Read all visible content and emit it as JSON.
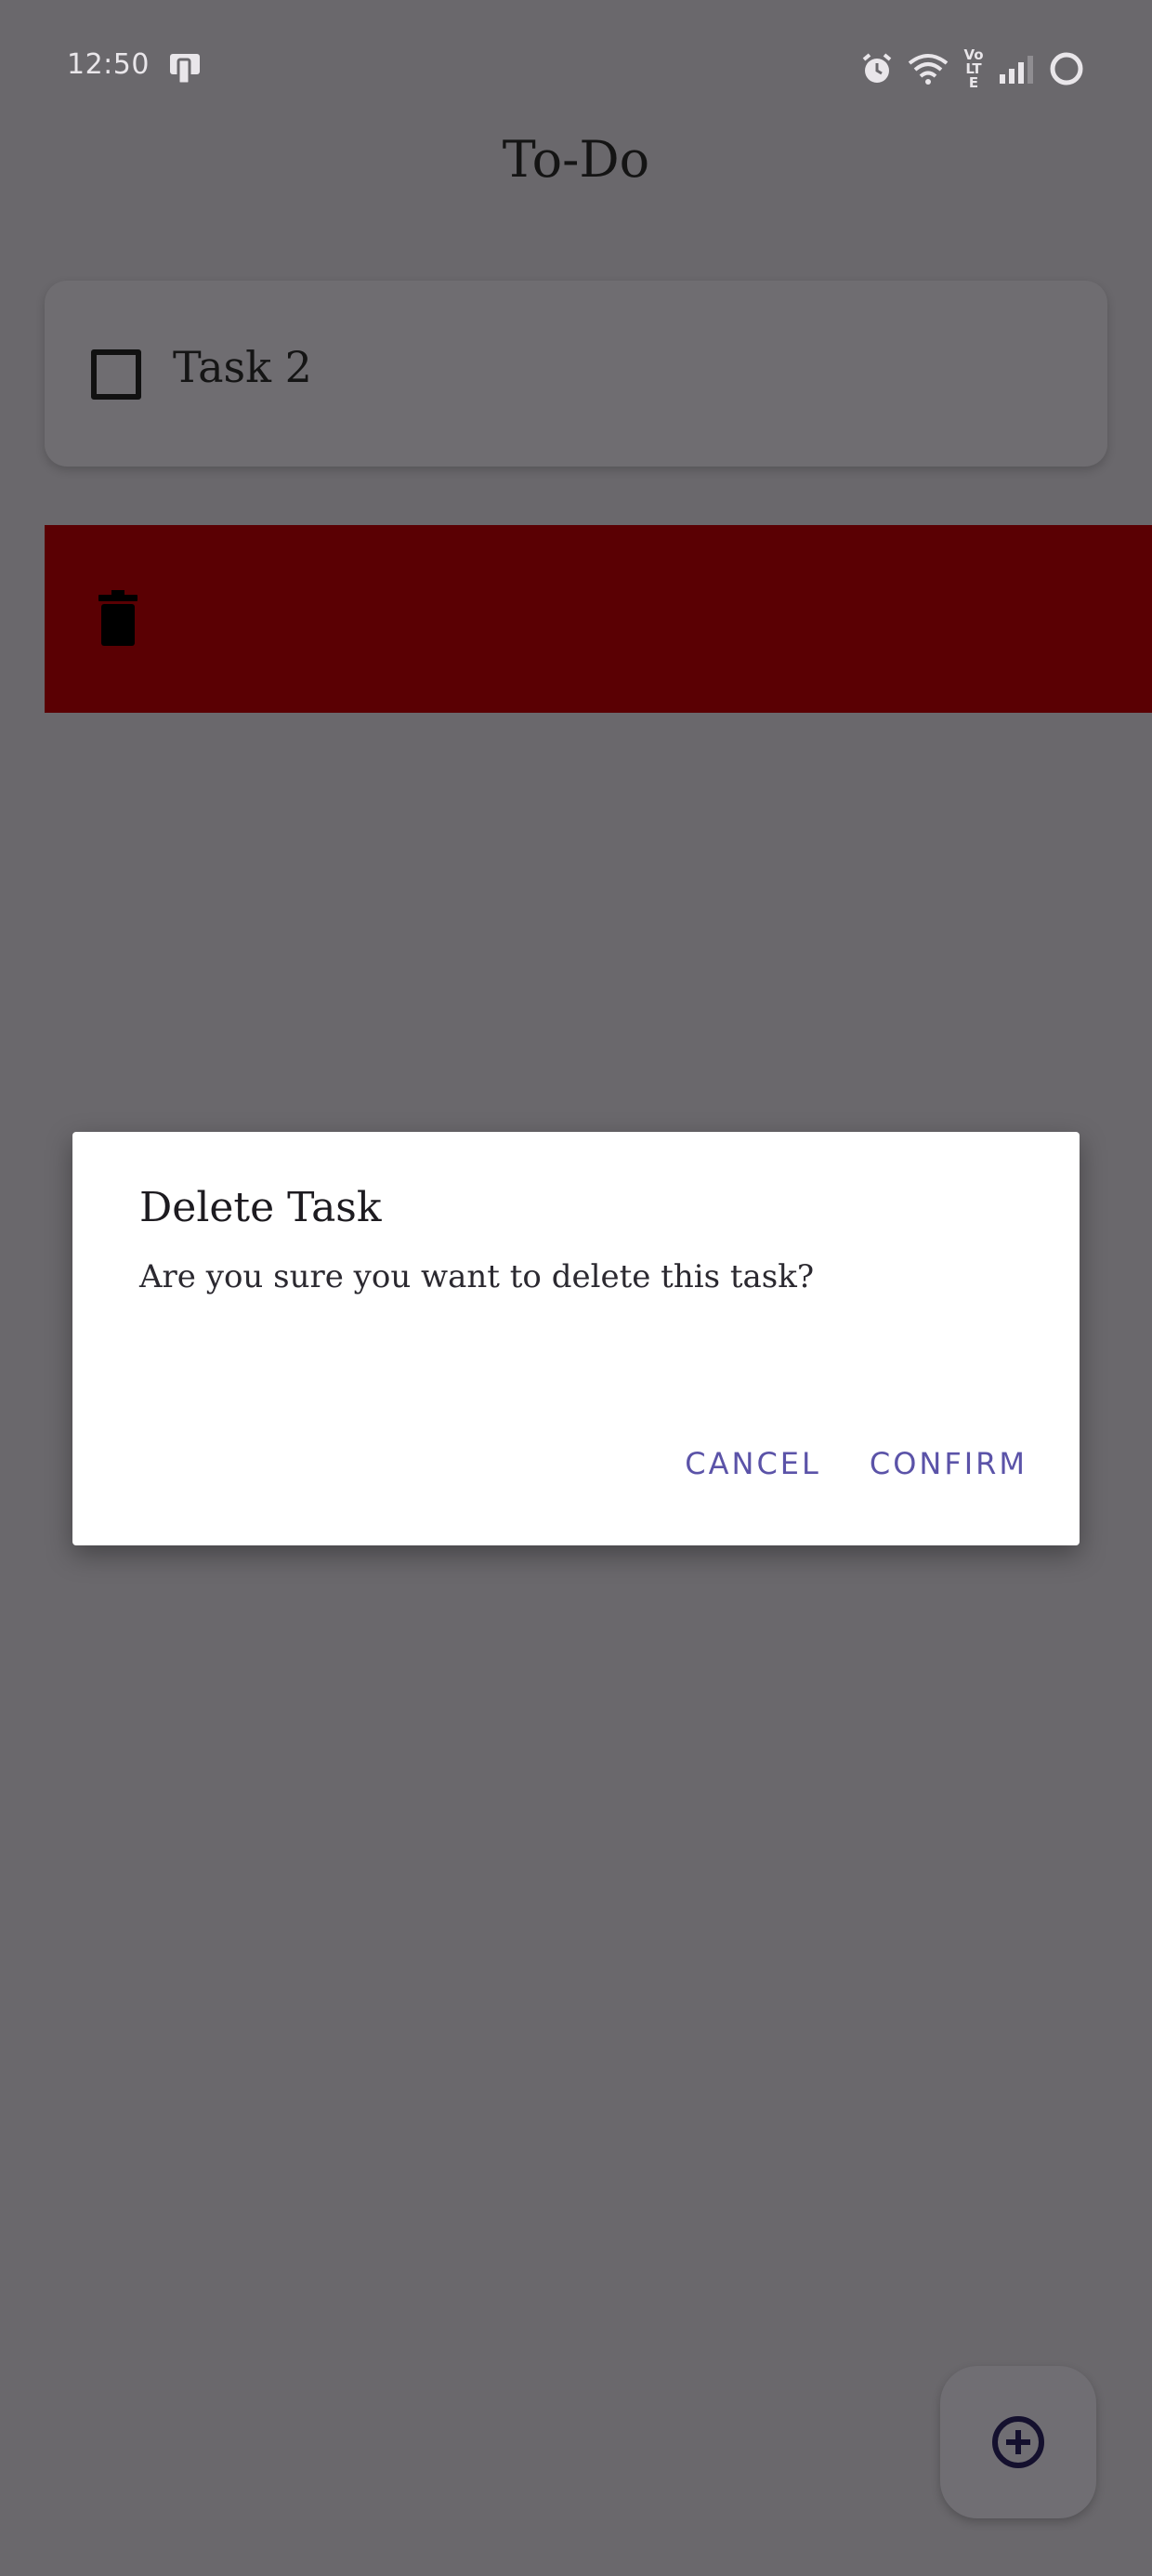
{
  "status_bar": {
    "time": "12:50",
    "icons": [
      "device-icon",
      "alarm-icon",
      "wifi-icon",
      "volte-icon",
      "signal-icon",
      "battery-icon"
    ],
    "volte_text": "Vo LTE"
  },
  "app": {
    "title": "To-Do"
  },
  "tasks": [
    {
      "label": "Task 2",
      "checked": false
    }
  ],
  "swipe": {
    "icon": "trash-icon",
    "color": "#5a0003"
  },
  "dialog": {
    "title": "Delete Task",
    "message": "Are you sure you want to delete this task?",
    "cancel_label": "CANCEL",
    "confirm_label": "CONFIRM",
    "accent": "#5b53a8"
  },
  "fab": {
    "icon": "add-circle-icon"
  }
}
